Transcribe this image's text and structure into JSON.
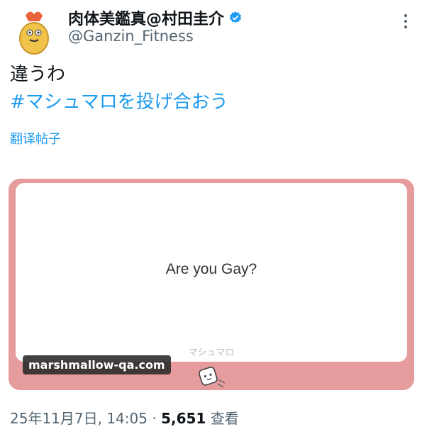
{
  "author": {
    "display_name": "肉体美鑑真@村田圭介",
    "handle": "@Ganzin_Fitness",
    "avatar_icon": "shrimp-avatar-icon"
  },
  "tweet": {
    "text": "違うわ",
    "hashtag": "#マシュマロを投げ合おう",
    "translate_label": "翻译帖子"
  },
  "card": {
    "question": "Are you Gay?",
    "brand_watermark": "マシュマロ",
    "domain": "marshmallow-qa.com",
    "background_color": "#e69b9c"
  },
  "meta": {
    "timestamp": "25年11月7日, 14:05",
    "separator": "·",
    "views_count": "5,651",
    "views_label": "查看"
  },
  "colors": {
    "link": "#1d9bf0",
    "secondary_text": "#536471",
    "verified": "#1d9bf0"
  }
}
